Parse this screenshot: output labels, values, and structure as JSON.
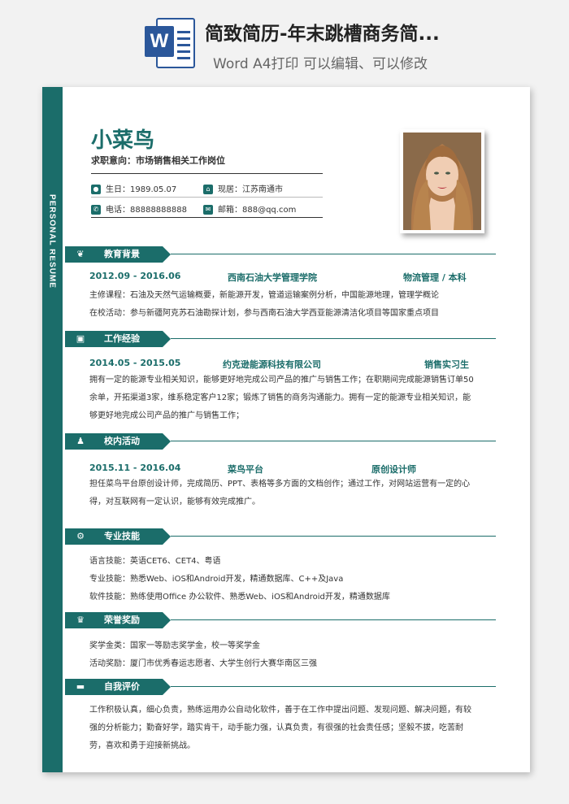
{
  "banner": {
    "icon_letter": "W",
    "title": "简致简历-年末跳槽商务简...",
    "subtitle": "Word A4打印 可以编辑、可以修改"
  },
  "resume": {
    "side_label": "PERSONAL RESUME",
    "name": "小菜鸟",
    "intent": "求职意向：市场销售相关工作岗位",
    "birth": "生日：1989.05.07",
    "residence": "现居：江苏南通市",
    "phone": "电话：88888888888",
    "email": "邮箱：888@qq.com"
  },
  "education": {
    "title": "教育背景",
    "period": "2012.09 - 2016.06",
    "school": "西南石油大学管理学院",
    "major": "物流管理 / 本科",
    "courses": "主修课程：石油及天然气运输概要，新能源开发，管道运输案例分析，中国能源地理，管理学概论",
    "activities": "在校活动：参与新疆阿克苏石油勘探计划，参与西南石油大学西亚能源清洁化项目等国家重点项目"
  },
  "work": {
    "title": "工作经验",
    "period": "2014.05 - 2015.05",
    "company": "约克逊能源科技有限公司",
    "role": "销售实习生",
    "desc": "拥有一定的能源专业相关知识，能够更好地完成公司产品的推广与销售工作；在职期间完成能源销售订单50余单，开拓渠道3家，维系稳定客户12家；锻炼了销售的商务沟通能力。拥有一定的能源专业相关知识，能够更好地完成公司产品的推广与销售工作；"
  },
  "campus": {
    "title": "校内活动",
    "period": "2015.11 - 2016.04",
    "org": "菜鸟平台",
    "role": "原创设计师",
    "desc": "担任菜鸟平台原创设计师，完成简历、PPT、表格等多方面的文档创作；通过工作，对网站运营有一定的心得，对互联网有一定认识，能够有效完成推广。"
  },
  "skills": {
    "title": "专业技能",
    "language": "语言技能：英语CET6、CET4、粤语",
    "professional": "专业技能：熟悉Web、iOS和Android开发，精通数据库、C++及Java",
    "software": "软件技能：熟练使用Office 办公软件、熟悉Web、iOS和Android开发，精通数据库"
  },
  "honors": {
    "title": "荣誉奖励",
    "scholarship": "奖学金类：国家一等励志奖学金，校一等奖学金",
    "activity": "活动奖励：厦门市优秀春运志愿者、大学生创行大赛华南区三强"
  },
  "self": {
    "title": "自我评价",
    "desc": "工作积极认真，细心负责，熟练运用办公自动化软件，善于在工作中提出问题、发现问题、解决问题，有较强的分析能力；勤奋好学，踏实肯干，动手能力强，认真负责，有很强的社会责任感；坚毅不拔，吃苦耐劳，喜欢和勇于迎接新挑战。"
  },
  "colors": {
    "accent": "#1b6d6a",
    "word_blue": "#2b579a"
  }
}
